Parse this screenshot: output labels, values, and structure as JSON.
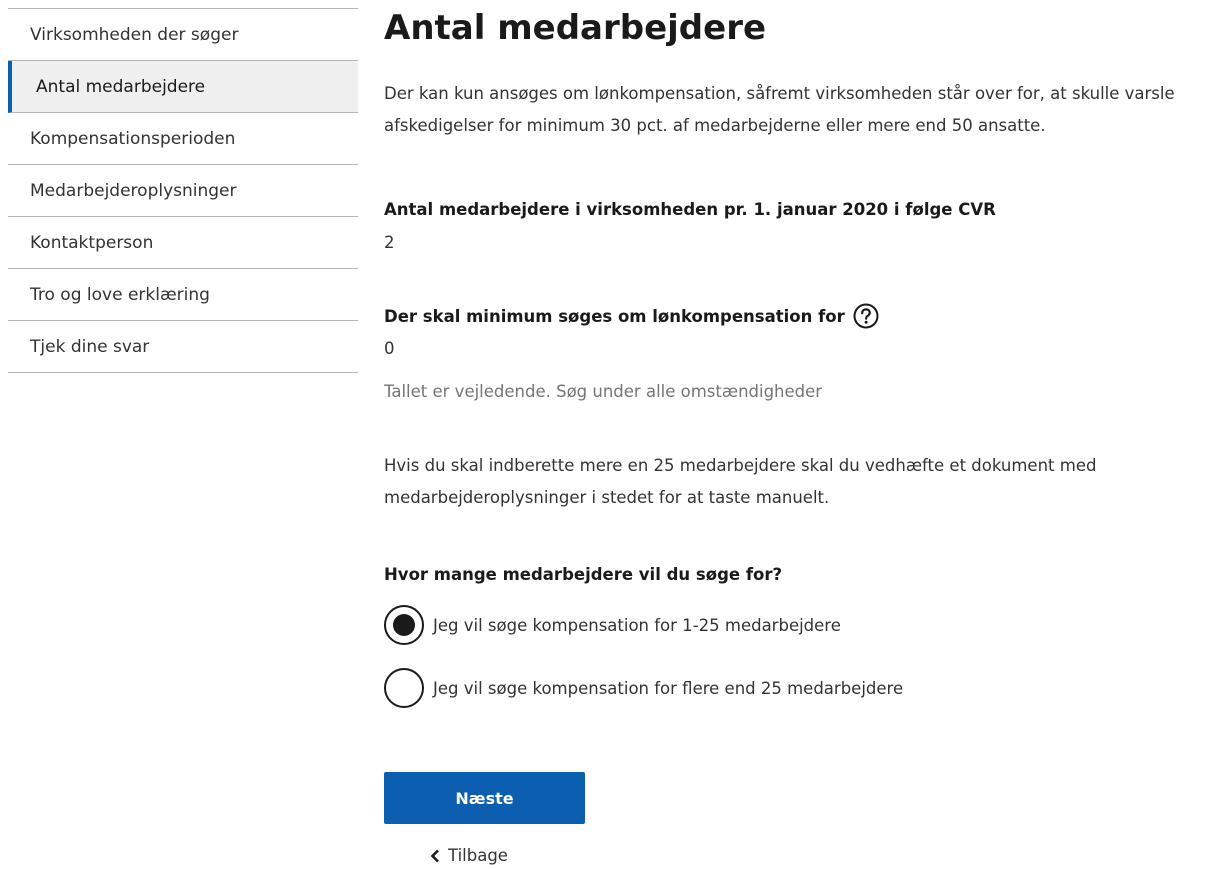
{
  "sidebar": {
    "items": [
      {
        "label": "Virksomheden der søger"
      },
      {
        "label": "Antal medarbejdere"
      },
      {
        "label": "Kompensationsperioden"
      },
      {
        "label": "Medarbejderoplysninger"
      },
      {
        "label": "Kontaktperson"
      },
      {
        "label": "Tro og love erklæring"
      },
      {
        "label": "Tjek dine svar"
      }
    ],
    "active_index": 1
  },
  "main": {
    "title": "Antal medarbejdere",
    "intro": "Der kan kun ansøges om lønkompensation, såfremt virksomheden står over for, at skulle varsle afskedigelser for minimum 30 pct. af medarbejderne eller mere end 50 ansatte.",
    "employees_label": "Antal medarbejdere i virksomheden pr. 1. januar 2020 i følge CVR",
    "employees_value": "2",
    "minimum_label": "Der skal minimum søges om lønkompensation for",
    "minimum_value": "0",
    "minimum_hint": "Tallet er vejledende. Søg under alle omstændigheder",
    "attachment_info": "Hvis du skal indberette mere en 25 medarbejdere skal du vedhæfte et dokument med medarbejderoplysninger i stedet for at taste manuelt.",
    "question": "Hvor mange medarbejdere vil du søge for?",
    "options": [
      {
        "label": "Jeg vil søge kompensation for 1-25 medarbejdere",
        "selected": true
      },
      {
        "label": "Jeg vil søge kompensation for flere end 25 medarbejdere",
        "selected": false
      }
    ],
    "next_button": "Næste",
    "back_link": "Tilbage"
  },
  "colors": {
    "accent": "#0b5eb0",
    "active_bg": "#efefef",
    "divider": "#b5b5b5",
    "hint": "#757575"
  },
  "icons": {
    "help": "question-circle-icon",
    "back": "chevron-left-icon"
  }
}
